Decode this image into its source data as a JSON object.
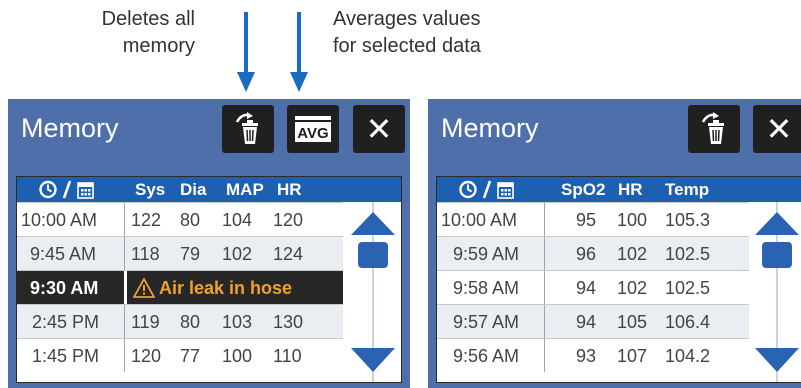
{
  "annotations": {
    "left_line1": "Deletes all",
    "left_line2": "memory",
    "right_line1": "Averages values",
    "right_line2": "for selected data"
  },
  "colors": {
    "arrow": "#1a6bc4",
    "header_bar": "#4f6fab",
    "table_header": "#1d5fb0",
    "alert_row_bg": "#272727",
    "alert_text": "#f0a22c",
    "scroll_arrow": "#2a63b2"
  },
  "left_screen": {
    "title": "Memory",
    "buttons": {
      "delete_icon": "trash-recycle-icon",
      "avg_label": "AVG",
      "close_label": "✕"
    },
    "columns": [
      "Sys",
      "Dia",
      "MAP",
      "HR"
    ],
    "rows": [
      {
        "time": "10:00 AM",
        "values": [
          "122",
          "80",
          "104",
          "120"
        ]
      },
      {
        "time": "9:45 AM",
        "values": [
          "118",
          "79",
          "102",
          "124"
        ]
      },
      {
        "time": "9:30 AM",
        "alert": "Air leak in hose"
      },
      {
        "time": "2:45 PM",
        "values": [
          "119",
          "80",
          "103",
          "130"
        ]
      },
      {
        "time": "1:45 PM",
        "values": [
          "120",
          "77",
          "100",
          "110"
        ]
      }
    ]
  },
  "right_screen": {
    "title": "Memory",
    "buttons": {
      "delete_icon": "trash-recycle-icon",
      "close_label": "✕"
    },
    "columns": [
      "SpO2",
      "HR",
      "Temp"
    ],
    "rows": [
      {
        "time": "10:00 AM",
        "values": [
          "95",
          "100",
          "105.3"
        ]
      },
      {
        "time": "9:59 AM",
        "values": [
          "96",
          "102",
          "102.5"
        ]
      },
      {
        "time": "9:58 AM",
        "values": [
          "94",
          "102",
          "102.5"
        ]
      },
      {
        "time": "9:57 AM",
        "values": [
          "94",
          "105",
          "106.4"
        ]
      },
      {
        "time": "9:56 AM",
        "values": [
          "93",
          "107",
          "104.2"
        ]
      }
    ]
  }
}
